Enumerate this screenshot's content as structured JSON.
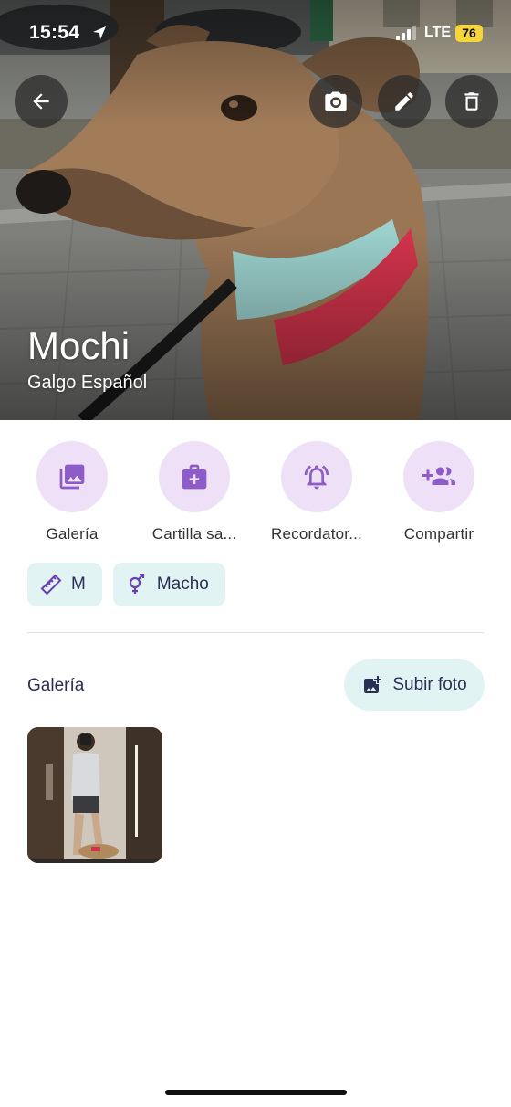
{
  "status_bar": {
    "time": "15:54",
    "network": "LTE",
    "battery": "76",
    "icons": [
      "location-arrow-icon",
      "signal-bars-icon"
    ]
  },
  "header": {
    "buttons": [
      "back-arrow-icon",
      "camera-icon",
      "pencil-icon",
      "trash-icon"
    ]
  },
  "pet": {
    "name": "Mochi",
    "breed": "Galgo Español"
  },
  "actions": [
    {
      "label": "Galería",
      "icon": "gallery-icon"
    },
    {
      "label": "Cartilla sa...",
      "icon": "medical-kit-icon"
    },
    {
      "label": "Recordator...",
      "icon": "bell-alert-icon"
    },
    {
      "label": "Compartir",
      "icon": "group-add-icon"
    }
  ],
  "chips": {
    "size": {
      "label": "M",
      "icon": "ruler-icon"
    },
    "sex": {
      "label": "Macho",
      "icon": "male-symbol-icon"
    }
  },
  "gallery": {
    "title": "Galería",
    "upload_label": "Subir foto",
    "upload_icon": "add-photo-icon",
    "photos_count": 1
  },
  "colors": {
    "accent_purple": "#7e57c2",
    "purple_bg": "#eee1f7",
    "teal_bg": "#e2f3f3",
    "text_dark": "#2b2f55",
    "battery": "#f4d63a"
  }
}
